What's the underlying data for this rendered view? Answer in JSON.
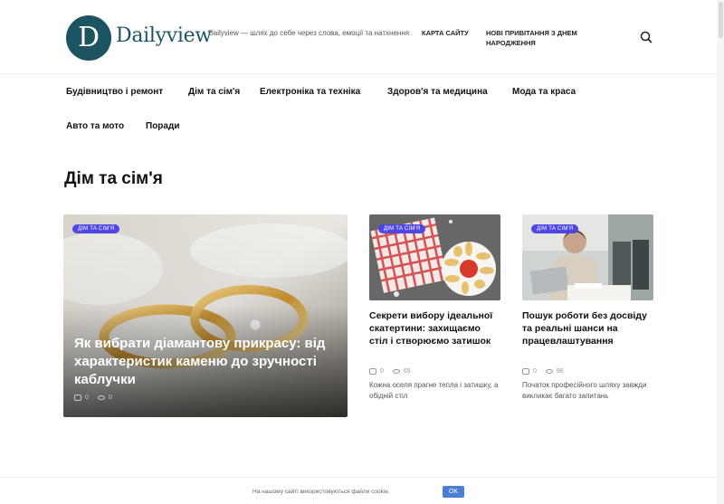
{
  "header": {
    "logo_letter": "D",
    "logo_text": "Dailyview",
    "tagline": "Dailyview — шлях до себе через слова, емоції та натхнення",
    "links": {
      "sitemap": "КАРТА САЙТУ",
      "greetings": "НОВІ ПРИВІТАННЯ З ДНЕМ НАРОДЖЕННЯ"
    }
  },
  "nav": {
    "items": [
      "Будівництво і ремонт",
      "Дім та сім'я",
      "Електроніка та техніка",
      "Здоров'я та медицина",
      "Мода та краса",
      "Авто та мото",
      "Поради"
    ]
  },
  "page": {
    "title": "Дім та сім'я"
  },
  "articles": {
    "featured": {
      "category": "ДІМ ТА СІМ'Я",
      "title": "Як вибрати діамантову прикрасу: від характеристик каменю до зручності каблучки",
      "comments": "0",
      "views": "0"
    },
    "second": {
      "category": "ДІМ ТА СІМ'Я",
      "title": "Секрети вибору ідеальної скатертини: захищаємо стіл і створюємо затишок",
      "comments": "0",
      "views": "65",
      "excerpt": "Кожна оселя прагне тепла і затишку, а обідній стіл"
    },
    "third": {
      "category": "ДІМ ТА СІМ'Я",
      "title": "Пошук роботи без досвіду та реальні шанси на працевлаштування",
      "comments": "0",
      "views": "96",
      "excerpt": "Початок професійного шляху завжди викликає багато запитань"
    }
  },
  "cookie": {
    "text": "На нашому сайті використовуються файли cookie.",
    "button": "OK"
  },
  "colors": {
    "brand": "#1d5462",
    "badge": "#4f46e5",
    "cookie_button": "#4a7dd6"
  }
}
